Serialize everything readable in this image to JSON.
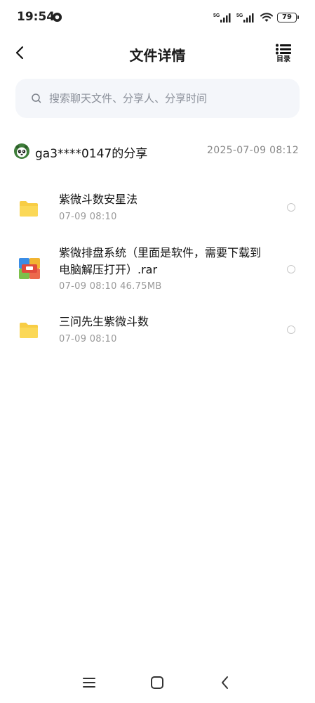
{
  "status_bar": {
    "time": "19:54",
    "battery": "79",
    "signal_1": "5G",
    "signal_2": "5G"
  },
  "header": {
    "title": "文件详情",
    "toc_label": "目录",
    "back_icon": "chevron-left-icon",
    "toc_icon": "list-icon"
  },
  "search": {
    "placeholder": "搜索聊天文件、分享人、分享时间",
    "value": ""
  },
  "share": {
    "sharer": "ga3****0147的分享",
    "time": "2025-07-09  08:12"
  },
  "files": [
    {
      "name": "紫微斗数安星法",
      "meta": "07-09  08:10",
      "type": "folder"
    },
    {
      "name": "紫微排盘系统（里面是软件，需要下载到电脑解压打开）.rar",
      "meta": "07-09  08:10   46.75MB",
      "type": "archive"
    },
    {
      "name": "三问先生紫微斗数",
      "meta": "07-09  08:10",
      "type": "folder"
    }
  ],
  "colors": {
    "folder": "#f8cd45",
    "search_bg": "#f4f6fa",
    "text_secondary": "#999999"
  }
}
